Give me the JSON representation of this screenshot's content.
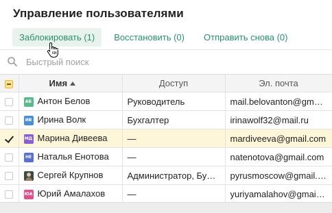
{
  "page": {
    "title": "Управление пользователями"
  },
  "actions": [
    {
      "label": "Заблокировать (1)"
    },
    {
      "label": "Восстановить (0)"
    },
    {
      "label": "Отправить снова (0)"
    }
  ],
  "search": {
    "placeholder": "Быстрый поиск"
  },
  "table": {
    "columns": {
      "name": "Имя",
      "access": "Доступ",
      "email": "Эл. почта"
    },
    "rows": [
      {
        "initials": "АБ",
        "avatar_color": "#5bb98c",
        "name": "Антон Белов",
        "access": "Руководитель",
        "email": "mail.belovanton@gmail.com",
        "selected": false
      },
      {
        "initials": "ИВ",
        "avatar_color": "#4a8fd6",
        "name": "Ирина Волк",
        "access": "Бухгалтер",
        "email": "irinawolf32@mail.ru",
        "selected": false
      },
      {
        "initials": "МД",
        "avatar_color": "#8b5fcf",
        "name": "Марина Дивеева",
        "access": "—",
        "email": "mardiveeva@gmail.com",
        "selected": true
      },
      {
        "initials": "НЕ",
        "avatar_color": "#5a6fd0",
        "name": "Наталья Енотова",
        "access": "—",
        "email": "natenotova@gmail.com",
        "selected": false
      },
      {
        "initials": "",
        "avatar_color": "#3b4b3e",
        "name": "Сергей Крупнов",
        "access": "Администратор, Бухгалтер",
        "email": "pyrusmoscow@gmail.com",
        "selected": false
      },
      {
        "initials": "ЮА",
        "avatar_color": "#e0508f",
        "name": "Юрий Амалахов",
        "access": "—",
        "email": "yuriyamalahov@gmail.com",
        "selected": false
      }
    ]
  },
  "colors": {
    "accent": "#2a8f6b",
    "selected_row": "#fdf6d8",
    "header_bg": "#f4f4f4"
  },
  "icons": {
    "search": "search-icon",
    "cursor": "hand-pointer-icon",
    "sort": "sort-asc-icon"
  }
}
